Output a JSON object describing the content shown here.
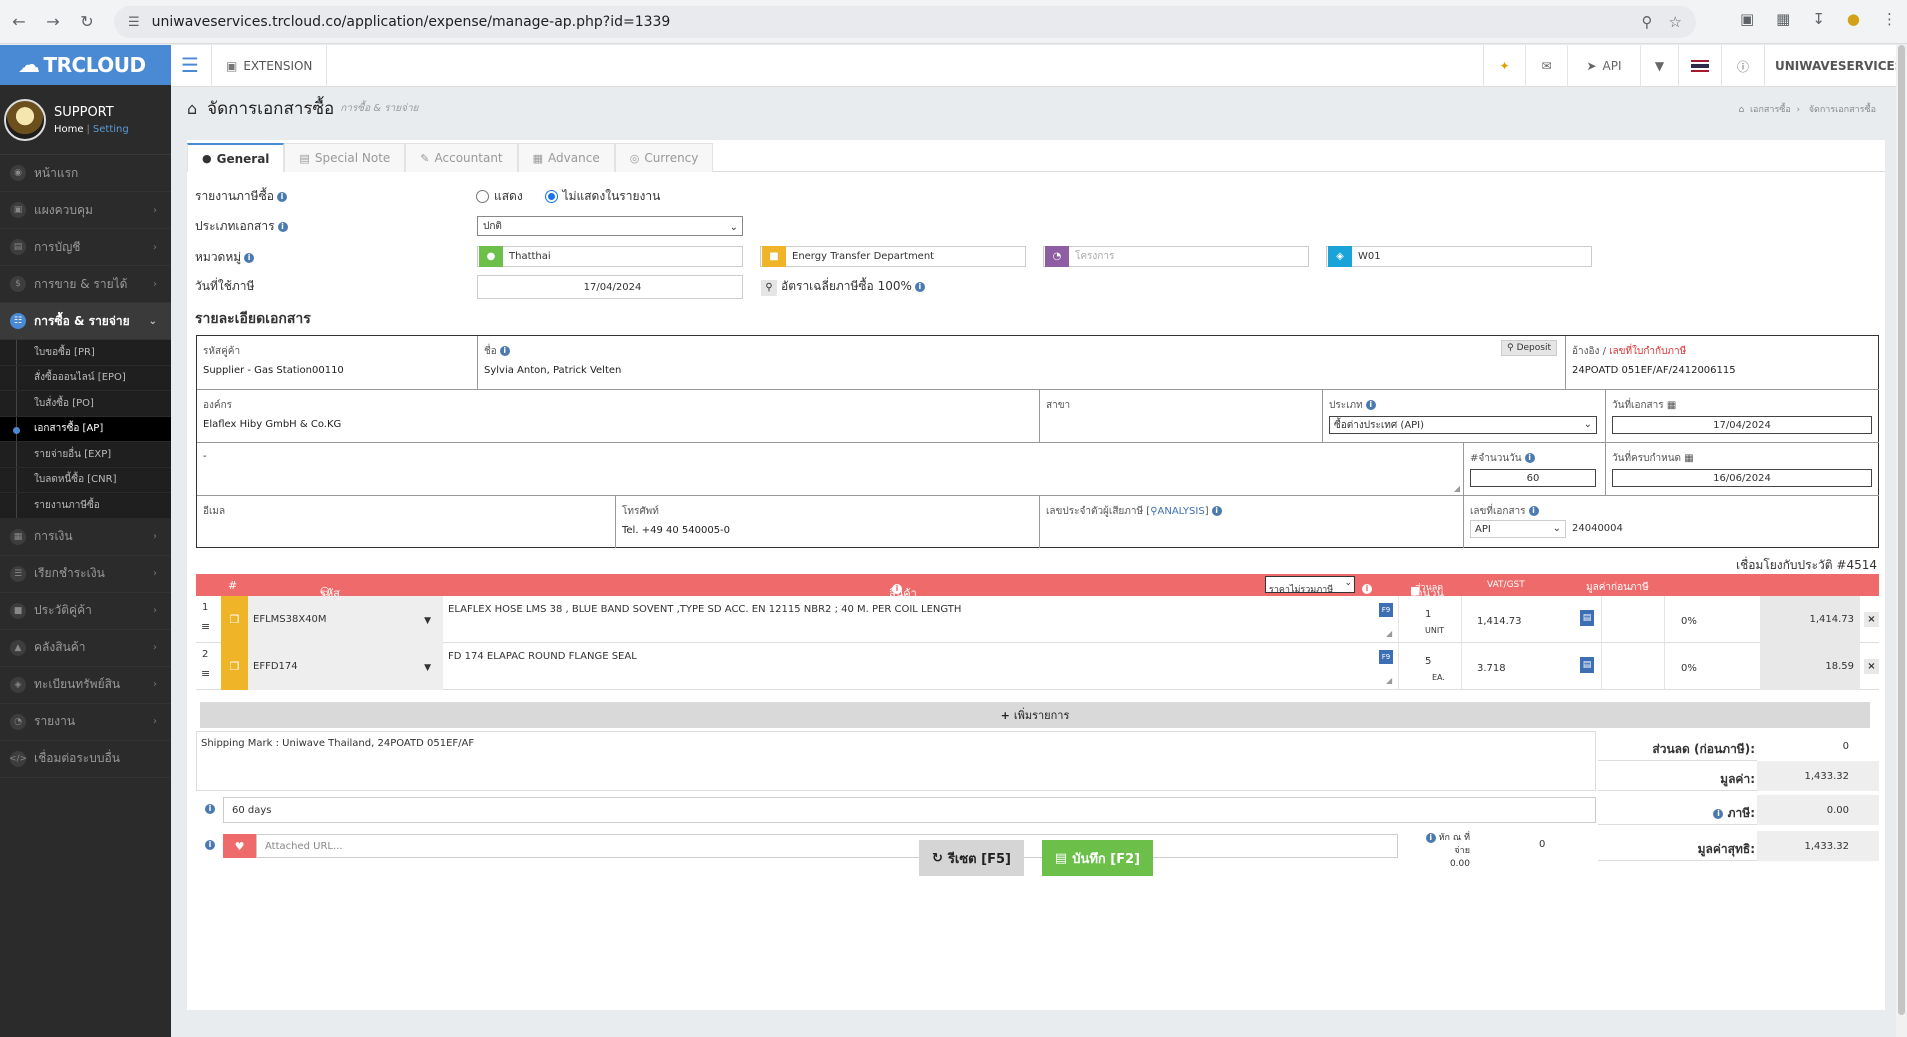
{
  "browser": {
    "url": "uniwaveservices.trcloud.co/application/expense/manage-ap.php?id=1339"
  },
  "sidebar": {
    "brand": "TRCLOUD",
    "user": "SUPPORT",
    "home_link": "Home",
    "setting_link": "Setting",
    "items": [
      {
        "label": "หน้าแรก",
        "icon": "dashboard-icon"
      },
      {
        "label": "แผงควบคุม",
        "icon": "monitor-icon"
      },
      {
        "label": "การบัญชี",
        "icon": "book-icon"
      },
      {
        "label": "การขาย & รายได้",
        "icon": "dollar-icon"
      },
      {
        "label": "การซื้อ & รายจ่าย",
        "icon": "cart-icon"
      }
    ],
    "subitems": [
      "ใบขอซื้อ [PR]",
      "สั่งซื้อออนไลน์ [EPO]",
      "ใบสั่งซื้อ [PO]",
      "เอกสารซื้อ [AP]",
      "รายจ่ายอื่น [EXP]",
      "ใบลดหนี้ซื้อ [CNR]",
      "รายงานภาษีซื้อ"
    ],
    "items2": [
      {
        "label": "การเงิน",
        "icon": "bank-icon"
      },
      {
        "label": "เรียกชำระเงิน",
        "icon": "list-icon"
      },
      {
        "label": "ประวัติคู่ค้า",
        "icon": "contacts-icon"
      },
      {
        "label": "คลังสินค้า",
        "icon": "warehouse-icon"
      },
      {
        "label": "ทะเบียนทรัพย์สิน",
        "icon": "asset-icon"
      },
      {
        "label": "รายงาน",
        "icon": "report-icon"
      },
      {
        "label": "เชื่อมต่อระบบอื่น",
        "icon": "code-icon"
      }
    ]
  },
  "topnav": {
    "extension": "EXTENSION",
    "api": "API",
    "company": "UNIWAVESERVICES"
  },
  "page": {
    "title": "จัดการเอกสารซื้อ",
    "subtitle": "การซื้อ & รายจ่าย",
    "crumb1": "เอกสารซื้อ",
    "crumb2": "จัดการเอกสารซื้อ"
  },
  "tabs": [
    "General",
    "Special Note",
    "Accountant",
    "Advance",
    "Currency"
  ],
  "form": {
    "tax_report_label": "รายงานภาษีซื้อ",
    "radio_show": "แสดง",
    "radio_hide": "ไม่แสดงในรายงาน",
    "doc_type_label": "ประเภทเอกสาร",
    "doc_type_value": "ปกติ",
    "category_label": "หมวดหมู่",
    "cat_person": "Thatthai",
    "cat_department": "Energy Transfer Department",
    "cat_project_placeholder": "โครงการ",
    "cat_job": "W01",
    "tax_date_label": "วันที่ใช้ภาษี",
    "tax_date_value": "17/04/2024",
    "avg_tax": "อัตราเฉลี่ยภาษีซื้อ 100%"
  },
  "details": {
    "section_title": "รายละเอียดเอกสาร",
    "supplier_code_label": "รหัสคู่ค้า",
    "supplier_code": "Supplier - Gas Station00110",
    "name_label": "ชื่อ",
    "name_value": "Sylvia Anton, Patrick Velten",
    "deposit": "Deposit",
    "ref_label": "อ้างอิง /",
    "ref_label_red": "เลขที่ใบกำกับภาษี",
    "ref_value": "24POATD 051EF/AF/2412006115",
    "org_label": "องค์กร",
    "org_value": "Elaflex Hiby  GmbH & Co.KG",
    "branch_label": "สาขา",
    "type_label": "ประเภท",
    "type_value": "ซื้อต่างประเทศ (API)",
    "doc_date_label": "วันที่เอกสาร",
    "doc_date_value": "17/04/2024",
    "address_value": "-",
    "credit_days_label": "#จำนวนวัน",
    "credit_days_value": "60",
    "due_date_label": "วันที่ครบกำหนด",
    "due_date_value": "16/06/2024",
    "email_label": "อีเมล",
    "phone_label": "โทรศัพท์",
    "phone_value": "Tel. +49 40 540005-0",
    "taxid_label": "เลขประจำตัวผู้เสียภาษี [",
    "taxid_link": "ANALYSIS",
    "taxid_close": "]",
    "docno_label": "เลขที่เอกสาร",
    "docno_prefix": "API",
    "docno_value": "24040004"
  },
  "history": "เชื่อมโยงกับประวัติ #4514",
  "items_head": {
    "hash": "#",
    "code": "รหัส",
    "product": "สินค้า",
    "qty": "จำนวน",
    "price_mode": "ราคาไม่รวมภาษี",
    "discount": "ส่วนลด",
    "vat": "VAT/GST",
    "total": "มูลค่าก่อนภาษี"
  },
  "items": [
    {
      "num": "1",
      "code": "EFLMS38X40M",
      "desc": "ELAFLEX HOSE LMS 38 , BLUE BAND SOVENT ,TYPE SD ACC. EN 12115 NBR2 ; 40 M. PER COIL LENGTH",
      "qty": "1",
      "unit": "UNIT",
      "price": "1,414.73",
      "vat": "0%",
      "total": "1,414.73"
    },
    {
      "num": "2",
      "code": "EFFD174",
      "desc": "FD 174 ELAPAC ROUND FLANGE SEAL",
      "qty": "5",
      "unit": "EA.",
      "price": "3.718",
      "vat": "0%",
      "total": "18.59"
    }
  ],
  "add_item": "เพิ่มรายการ",
  "summary": {
    "note": "Shipping Mark : Uniwave Thailand, 24POATD 051EF/AF",
    "terms": "60 days",
    "url_placeholder": "Attached URL...",
    "wht_label": "หัก ณ ที่จ่าย",
    "wht_amount": "0.00",
    "wht_value": "0",
    "discount_label": "ส่วนลด (ก่อนภาษี):",
    "discount_value": "0",
    "subtotal_label": "มูลค่า:",
    "subtotal_value": "1,433.32",
    "tax_label": "ภาษี:",
    "tax_value": "0.00",
    "net_label": "มูลค่าสุทธิ:",
    "net_value": "1,433.32"
  },
  "buttons": {
    "reset": "รีเซต [F5]",
    "save": "บันทึก [F2]"
  }
}
